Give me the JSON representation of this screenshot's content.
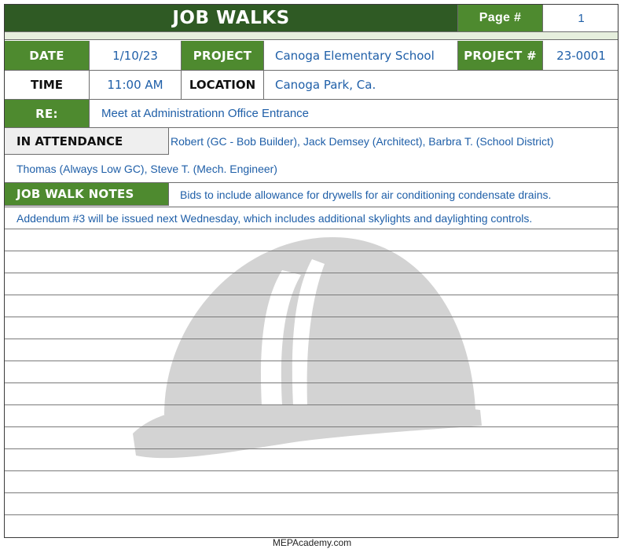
{
  "title": "JOB WALKS",
  "page_label": "Page #",
  "page_number": "1",
  "date_label": "DATE",
  "date": "1/10/23",
  "project_label": "PROJECT",
  "project": "Canoga Elementary School",
  "project_num_label": "PROJECT #",
  "project_number": "23-0001",
  "time_label": "TIME",
  "time": "11:00 AM",
  "location_label": "LOCATION",
  "location": "Canoga Park, Ca.",
  "re_label": "RE:",
  "re": "Meet at Administrationn Office Entrance",
  "attendance_label": "IN ATTENDANCE",
  "attendance_line1": "Robert (GC - Bob Builder), Jack Demsey (Architect), Barbra T. (School District)",
  "attendance_line2": "Thomas (Always Low GC), Steve T. (Mech. Engineer)",
  "notes_label": "JOB WALK NOTES",
  "notes_line1": "Bids to include allowance for drywells for air conditioning condensate drains.",
  "notes_line2": "Addendum #3 will be issued next Wednesday, which includes additional skylights and daylighting controls.",
  "watermark_icon": "hard-hat-icon",
  "footer": "MEPAcademy.com",
  "colors": {
    "header_green": "#2f5a24",
    "label_green": "#4e8a2f",
    "value_blue": "#1f5fa8",
    "watermark": "#d6d6d6"
  }
}
